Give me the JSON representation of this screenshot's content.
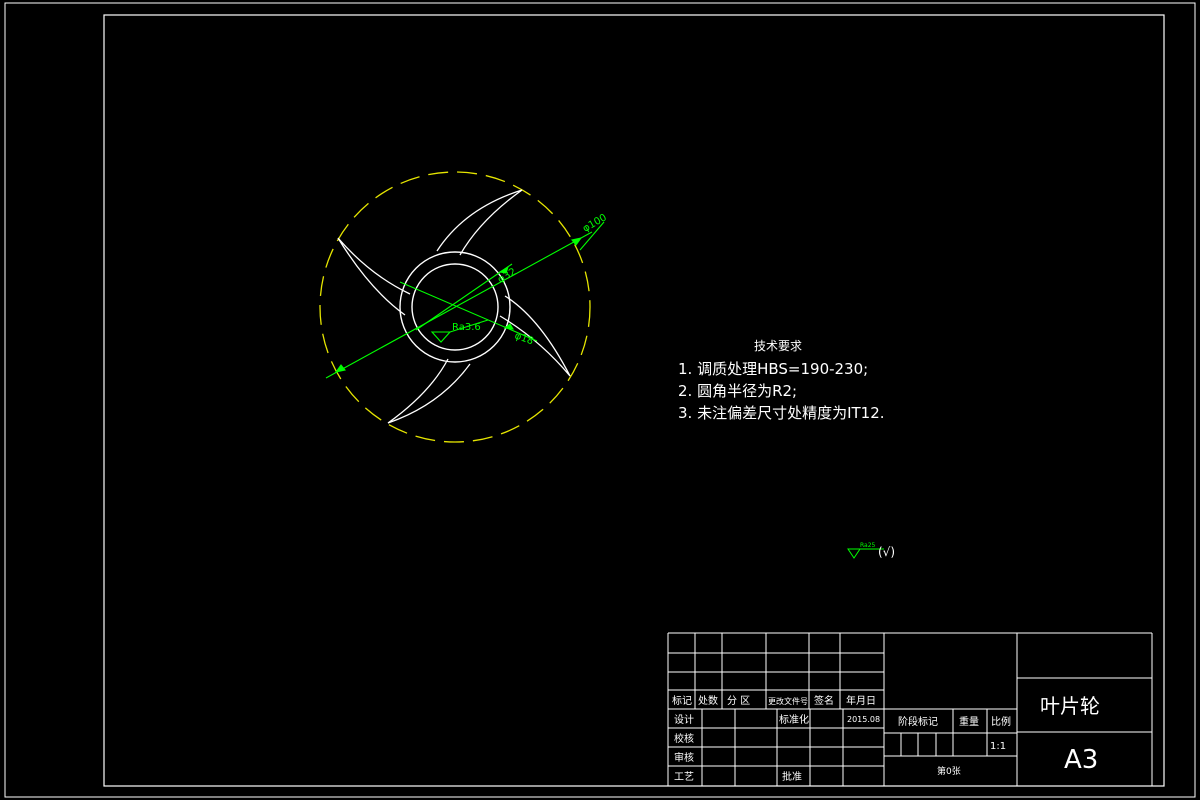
{
  "drawing": {
    "dimensions": {
      "outer_diameter": "φ100",
      "hub_diameter": "φ32",
      "bore_diameter": "φ18",
      "bore_roughness": "Ra3.6"
    },
    "tech_requirements": {
      "title": "技术要求",
      "items": [
        "1. 调质处理HBS=190-230;",
        "2. 圆角半径为R2;",
        "3. 未注偏差尺寸处精度为IT12."
      ]
    },
    "roughness_note": {
      "value": "Ra25",
      "suffix": "(√)"
    }
  },
  "title_block": {
    "rev_headers": [
      "标记",
      "处数",
      "分 区",
      "更改文件号",
      "签名",
      "年月日"
    ],
    "design_label": "设计",
    "standardize_label": "标准化",
    "date": "2015.08",
    "check_label": "校核",
    "review_label": "审核",
    "process_label": "工艺",
    "approve_label": "批准",
    "stage_mark_label": "阶段标记",
    "weight_label": "重量",
    "scale_label": "比例",
    "scale_value": "1:1",
    "sheet_label": "第0张",
    "part_name": "叶片轮",
    "paper_size": "A3"
  }
}
